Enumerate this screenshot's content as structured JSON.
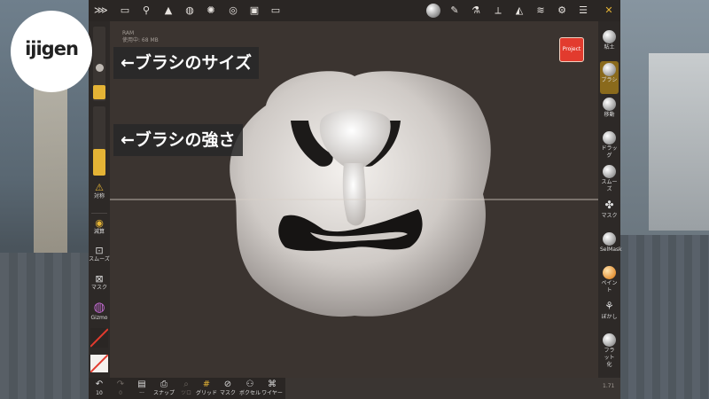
{
  "logo": {
    "text": "ijigen"
  },
  "annotations": {
    "size": "←ブラシのサイズ",
    "strength": "←ブラシの強さ"
  },
  "topbar": {
    "icons": [
      "menu-icon",
      "folder-icon",
      "scene-graph-icon",
      "topology-icon",
      "material-globe-icon",
      "light-sun-icon",
      "camera-aperture-icon",
      "image-icon",
      "video-icon"
    ],
    "right_icons": [
      "matcap-sphere-icon",
      "pen-icon",
      "eyedropper-icon",
      "cube-slice-icon",
      "triangle-icon",
      "layers-icon",
      "settings-gear-icon",
      "sliders-icon",
      "tools-icon"
    ]
  },
  "ram": {
    "label": "RAM",
    "usage": "使用中: 68 MB"
  },
  "project_button": {
    "label": "Project",
    "color": "#e23b2e"
  },
  "left_toolbar": {
    "size_value": 0.35,
    "strength_value": 0.22,
    "items": [
      {
        "symbol": "⚠",
        "label": "対称"
      },
      {
        "symbol": "◉",
        "label": "減算"
      },
      {
        "symbol": "⊡",
        "label": "スムーズ"
      },
      {
        "symbol": "⊠",
        "label": "マスク"
      },
      {
        "symbol": "◍",
        "label": "Gizmo"
      }
    ]
  },
  "right_toolbar": {
    "items": [
      {
        "label": "粘土",
        "active": false
      },
      {
        "label": "ブラシ",
        "active": true
      },
      {
        "label": "移動",
        "active": false
      },
      {
        "label": "ドラッグ",
        "active": false
      },
      {
        "label": "スムーズ",
        "active": false
      },
      {
        "label": "マスク",
        "active": false
      },
      {
        "label": "SelMask",
        "active": false
      },
      {
        "label": "ペイント",
        "active": false
      },
      {
        "label": "ぼかし",
        "active": false
      },
      {
        "label": "フラット化",
        "active": false
      }
    ],
    "accent": "#e4b335"
  },
  "bottom_toolbar": {
    "undo_count": "10",
    "redo_count": "0",
    "items": [
      {
        "symbol": "▤",
        "label": "···",
        "dim": false
      },
      {
        "symbol": "⎙",
        "label": "スナップ",
        "dim": false
      },
      {
        "symbol": "⌕",
        "label": "ツロ",
        "dim": true
      },
      {
        "symbol": "#",
        "label": "グリッド",
        "dim": false
      },
      {
        "symbol": "⊘",
        "label": "マスク",
        "dim": false
      },
      {
        "symbol": "⚇",
        "label": "ボクセル",
        "dim": false
      },
      {
        "symbol": "⌘",
        "label": "ワイヤー",
        "dim": false
      }
    ]
  },
  "version": {
    "text": "1.71"
  }
}
